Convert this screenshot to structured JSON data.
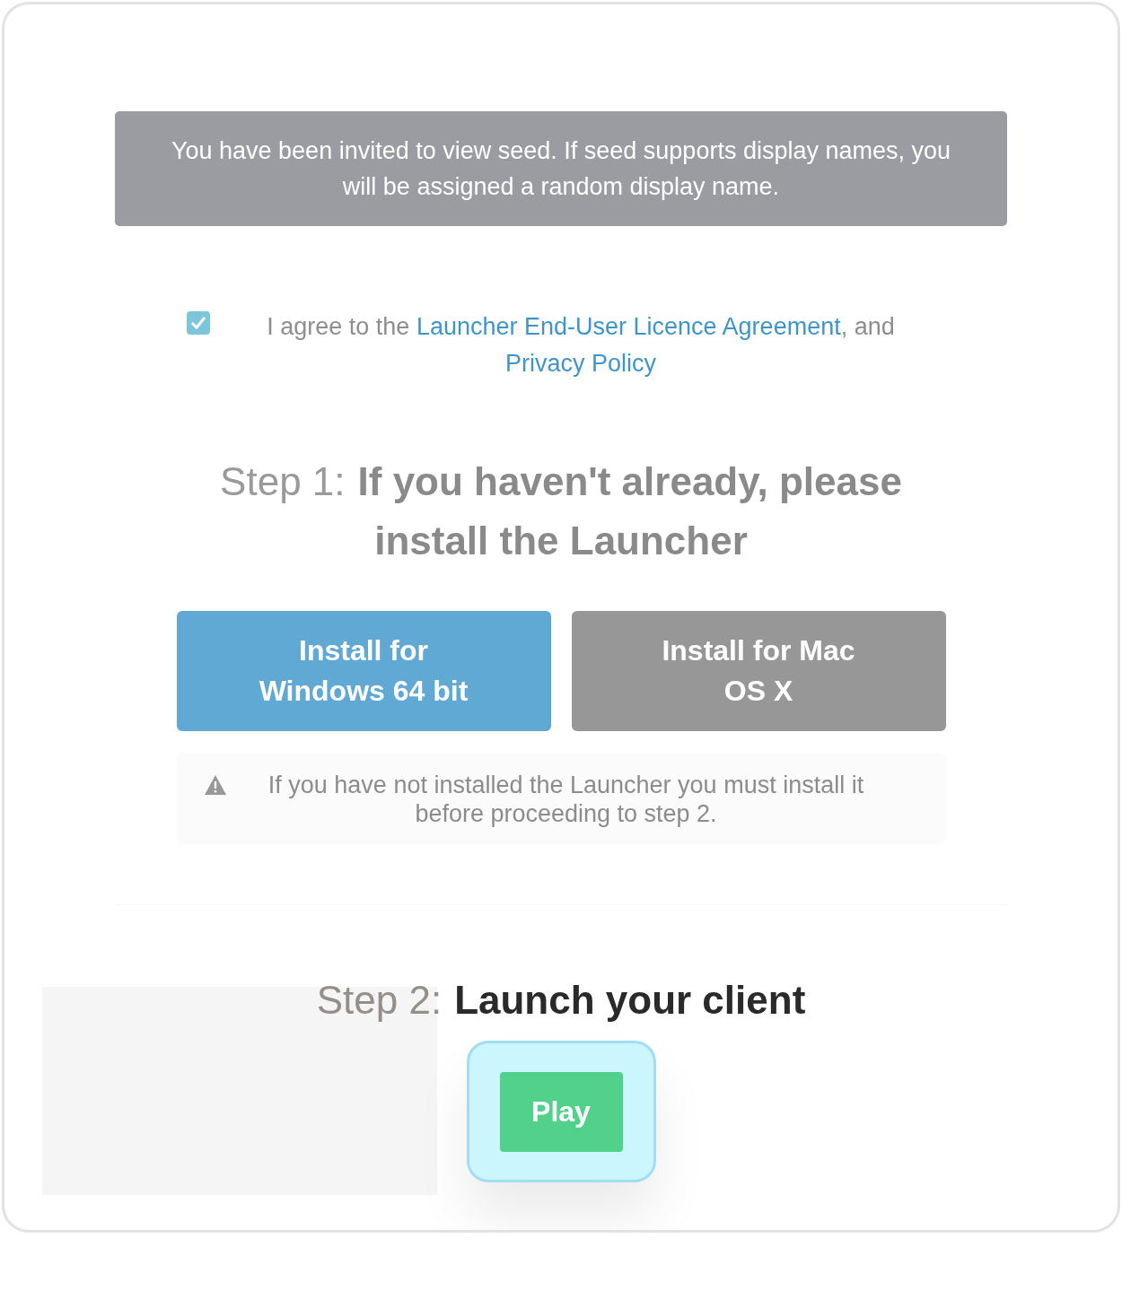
{
  "notice": {
    "text": "You have been invited to view seed. If seed supports display names, you will be assigned a random display name."
  },
  "agreement": {
    "checked": true,
    "text_before": "I agree to the ",
    "link_1": "Launcher End-User Licence Agreement",
    "text_between": ", and",
    "link_2": "Privacy Policy"
  },
  "step_1": {
    "label": "Step 1:",
    "title": "If you haven't already, please install the Launcher",
    "buttons": [
      {
        "label": "Install for Windows 64 bit",
        "kind": "primary"
      },
      {
        "label": "Install for Mac OS X",
        "kind": "secondary"
      }
    ],
    "warning": "If you have not installed the Launcher you must install it before proceeding to step 2."
  },
  "step_2": {
    "label": "Step 2:",
    "title": "Launch your client",
    "play_button": {
      "label": "Play",
      "highlighted": true
    }
  }
}
